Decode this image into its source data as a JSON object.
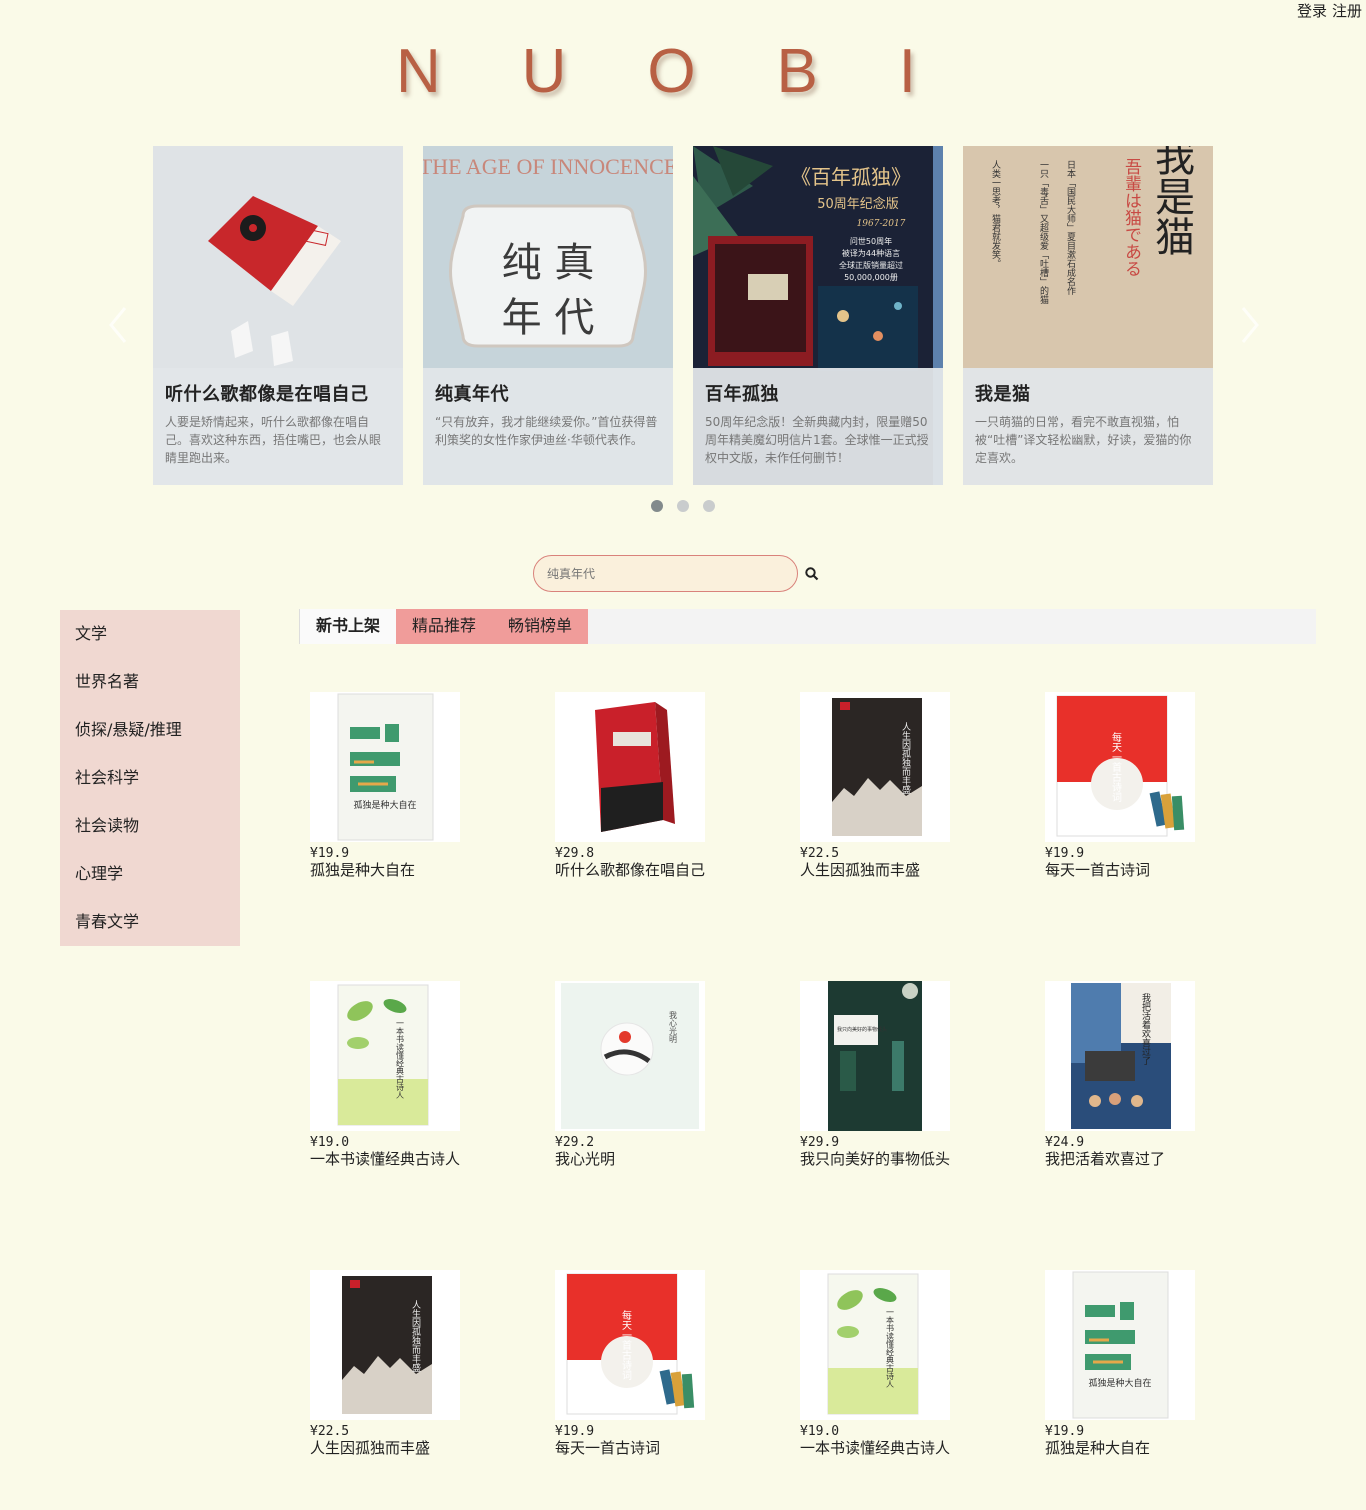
{
  "auth": {
    "login": "登录",
    "register": "注册"
  },
  "logo": [
    "N",
    "U",
    "O",
    "B",
    "I"
  ],
  "carousel": {
    "slides": [
      {
        "title": "听什么歌都像是在唱自己",
        "desc": "人要是矫情起来，听什么歌都像在唱自己。喜欢这种东西，捂住嘴巴，也会从眼睛里跑出来。"
      },
      {
        "title": "纯真年代",
        "desc": "“只有放弃，我才能继续爱你。”首位获得普利策奖的女性作家伊迪丝·华顿代表作。",
        "art_heading": "THE AGE OF INNOCENCE",
        "art_line1": "纯 真",
        "art_line2": "年 代"
      },
      {
        "title": "百年孤独",
        "desc": "50周年纪念版！全新典藏内封，限量赠50周年精美魔幻明信片1套。全球惟一正式授权中文版，未作任何删节！",
        "art_heading": "《百年孤独》",
        "art_sub": "50周年纪念版",
        "art_years": "1967-2017",
        "art_note1": "问世50周年",
        "art_note2": "被译为44种语言",
        "art_note3": "全球正版销量超过",
        "art_note4": "50,000,000册"
      },
      {
        "title": "我是猫",
        "desc": "一只萌猫的日常，看完不敢直视猫，怕被“吐槽”译文轻松幽默，好读，爱猫的你定喜欢。",
        "art_big": "我是猫",
        "art_jp": "吾輩は猫である",
        "art_v1": "日本「国民大师」夏目漱石成名作",
        "art_v2": "一只「毒舌」又超级爱「吐槽」的猫",
        "art_v3": "人类一思考，猫君就发笑。"
      }
    ],
    "active_dot": 0,
    "dot_count": 3
  },
  "search": {
    "placeholder": "纯真年代"
  },
  "sidebar": {
    "items": [
      "文学",
      "世界名著",
      "侦探/悬疑/推理",
      "社会科学",
      "社会读物",
      "心理学",
      "青春文学"
    ]
  },
  "tabs": [
    "新书上架",
    "精品推荐",
    "畅销榜单"
  ],
  "books": [
    {
      "price": "¥19.9",
      "name": "孤独是种大自在",
      "cover": "solitude"
    },
    {
      "price": "¥29.8",
      "name": "听什么歌都像在唱自己",
      "cover": "red"
    },
    {
      "price": "¥22.5",
      "name": "人生因孤独而丰盛",
      "cover": "dark"
    },
    {
      "price": "¥19.9",
      "name": "每天一首古诗词",
      "cover": "poem"
    },
    {
      "price": "¥19.0",
      "name": "一本书读懂经典古诗人",
      "cover": "leaf"
    },
    {
      "price": "¥29.2",
      "name": "我心光明",
      "cover": "light"
    },
    {
      "price": "¥29.9",
      "name": "我只向美好的事物低头",
      "cover": "green"
    },
    {
      "price": "¥24.9",
      "name": "我把活着欢喜过了",
      "cover": "city"
    },
    {
      "price": "¥22.5",
      "name": "人生因孤独而丰盛",
      "cover": "dark"
    },
    {
      "price": "¥19.9",
      "name": "每天一首古诗词",
      "cover": "poem"
    },
    {
      "price": "¥19.0",
      "name": "一本书读懂经典古诗人",
      "cover": "leaf"
    },
    {
      "price": "¥19.9",
      "name": "孤独是种大自在",
      "cover": "solitude"
    }
  ],
  "cover_text": {
    "solitude": "孤独是种大自在",
    "dark": "人生因孤独而丰盛",
    "poem": "每天一首古诗词",
    "leaf": "一本书读懂经典古诗人",
    "light": "我心光明",
    "green": "我只向美好的事物低头",
    "city": "我把活着欢喜过了"
  },
  "colors": {
    "background": "#fafae8",
    "logo": "#b86044",
    "sidebar": "#f0d8d1",
    "tab_pink": "#f09c9a",
    "search_border": "#d9827b"
  }
}
